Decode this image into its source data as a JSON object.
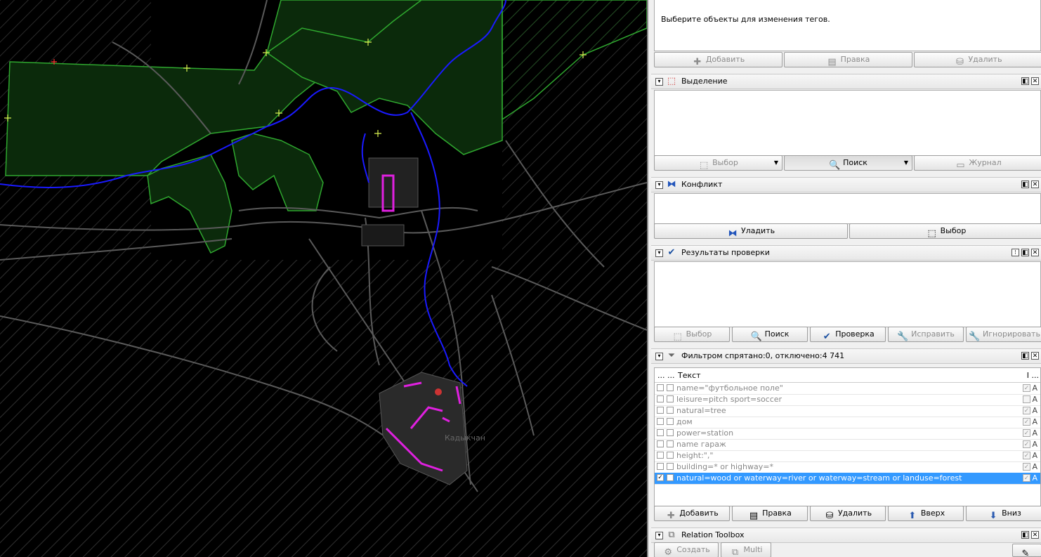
{
  "map": {
    "town_label": "Кадыкчан"
  },
  "tags_panel": {
    "message": "Выберите объекты для изменения тегов.",
    "buttons": {
      "add": "Добавить",
      "edit": "Правка",
      "delete": "Удалить"
    }
  },
  "selection_panel": {
    "title": "Выделение",
    "buttons": {
      "select": "Выбор",
      "search": "Поиск",
      "history": "Журнал"
    }
  },
  "conflict_panel": {
    "title": "Конфликт",
    "buttons": {
      "resolve": "Уладить",
      "select": "Выбор"
    }
  },
  "validation_panel": {
    "title": "Результаты проверки",
    "buttons": {
      "select": "Выбор",
      "search": "Поиск",
      "validate": "Проверка",
      "fix": "Исправить",
      "ignore": "Игнорировать"
    }
  },
  "filter_panel": {
    "title": "Фильтром спрятано:0, отключено:4 741",
    "columns": {
      "enabled": "...",
      "hide": "...",
      "text": "Текст",
      "inverted": "I",
      "mode": "..."
    },
    "rows": [
      {
        "text": "name=\"футбольное поле\"",
        "enabled": false,
        "inverted": true,
        "mode": "A"
      },
      {
        "text": "leisure=pitch sport=soccer",
        "enabled": false,
        "inverted": false,
        "mode": "A"
      },
      {
        "text": "natural=tree",
        "enabled": false,
        "inverted": true,
        "mode": "A"
      },
      {
        "text": "дом",
        "enabled": false,
        "inverted": true,
        "mode": "A"
      },
      {
        "text": "power=station",
        "enabled": false,
        "inverted": true,
        "mode": "A"
      },
      {
        "text": "name гараж",
        "enabled": false,
        "inverted": true,
        "mode": "A"
      },
      {
        "text": "height:\",\"",
        "enabled": false,
        "inverted": true,
        "mode": "A"
      },
      {
        "text": "building=* or highway=*",
        "enabled": false,
        "inverted": true,
        "mode": "A"
      },
      {
        "text": "natural=wood or waterway=river or waterway=stream or landuse=forest",
        "enabled": true,
        "inverted": true,
        "mode": "A",
        "selected": true
      }
    ],
    "buttons": {
      "add": "Добавить",
      "edit": "Правка",
      "delete": "Удалить",
      "up": "Вверх",
      "down": "Вниз"
    }
  },
  "relation_panel": {
    "title": "Relation Toolbox",
    "buttons": {
      "create": "Создать",
      "multi": "Multi"
    }
  },
  "colors": {
    "forest_fill": "#0b2a0b",
    "forest_stroke": "#2fa82f",
    "river": "#1a1aff",
    "road": "#5a5a5a",
    "highlight": "#e020e0",
    "selection_blue": "#3399ff"
  }
}
